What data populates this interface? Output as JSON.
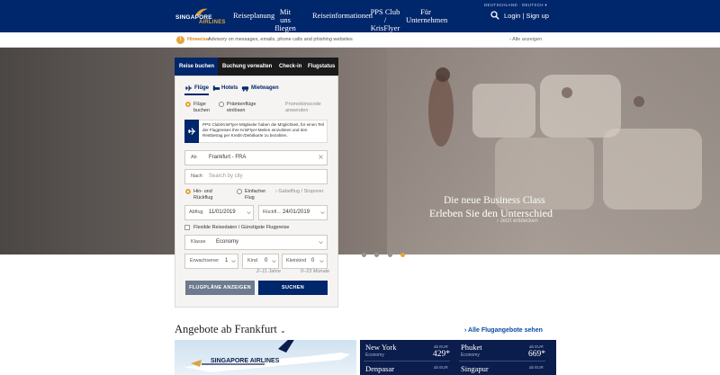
{
  "header": {
    "brand_line1": "SINGAPORE",
    "brand_line2": "AIRLINES",
    "nav": [
      {
        "label": "Reiseplanung"
      },
      {
        "label": "Mit\nuns fliegen"
      },
      {
        "label": "Reiseinformationen"
      },
      {
        "label": "PPS Club /\nKrisFlyer"
      },
      {
        "label": "Für\nUnternehmen"
      }
    ],
    "language": "DEUTSCHLAND · DEUTSCH ▾",
    "login": "Login | Sign up"
  },
  "notice": {
    "label": "Hinweise:",
    "text": "Advisory on messages, emails, phone calls and phishing websites",
    "link": "Alle anzeigen"
  },
  "booking": {
    "tabs": [
      "Reise buchen",
      "Buchung verwalten",
      "Check-in",
      "Flugstatus"
    ],
    "subtabs": [
      "Flüge",
      "Hotels",
      "Mietwagen"
    ],
    "flight_type": {
      "option1": "Flüge\nbuchen",
      "option2": "Prämienflüge\neinlösen",
      "promo": "Promotionscode\nanwenden"
    },
    "info": "PPS Club/KrisFlyer-Mitglieder haben die Möglichkeit, für einen Teil der Flugpreises Ihre KrisFlyer-Meilen einzulösen und den Restbetrag per Kredit-/Debitkarte zu bezahlen.",
    "from_label": "Ab",
    "from_value": "Frankfurt - FRA",
    "to_label": "Nach",
    "to_placeholder": "Search by city",
    "trip": {
      "roundtrip": "Hin- und\nRückflug",
      "oneway": "Einfacher\nFlug",
      "multi": "Gabelflug / Stopover"
    },
    "depart_label": "Abflug",
    "depart_value": "11/01/2019",
    "return_label": "Rückfl...",
    "return_value": "24/01/2019",
    "flexible": "Flexible Reisedaten / Günstigste Flugpreise",
    "class_label": "Klasse",
    "class_value": "Economy",
    "adults_label": "Erwachsener",
    "adults_value": "1",
    "child_label": "Kind",
    "child_value": "0",
    "child_hint": "2–11 Jahre",
    "infant_label": "Kleinkind",
    "infant_value": "0",
    "infant_hint": "0–23 Monate",
    "schedule_button": "FLUGPLÄNE ANZEIGEN",
    "search_button": "SUCHEN"
  },
  "hero": {
    "title1": "Die neue Business Class",
    "title2": "Erleben Sie den Unterschied",
    "link": "Jetzt entdecken",
    "slides": 4,
    "active_slide": 4
  },
  "offers": {
    "title": "Angebote ab Frankfurt",
    "all_link": "Alle Flugangebote sehen",
    "items": [
      {
        "city": "New York",
        "class": "Economy",
        "from": "ab EUR",
        "price": "429*"
      },
      {
        "city": "Phuket",
        "class": "Economy",
        "from": "ab EUR",
        "price": "669*"
      },
      {
        "city": "Denpasar",
        "class": "",
        "from": "ab EUR",
        "price": ""
      },
      {
        "city": "Singapur",
        "class": "",
        "from": "ab EUR",
        "price": ""
      }
    ]
  }
}
